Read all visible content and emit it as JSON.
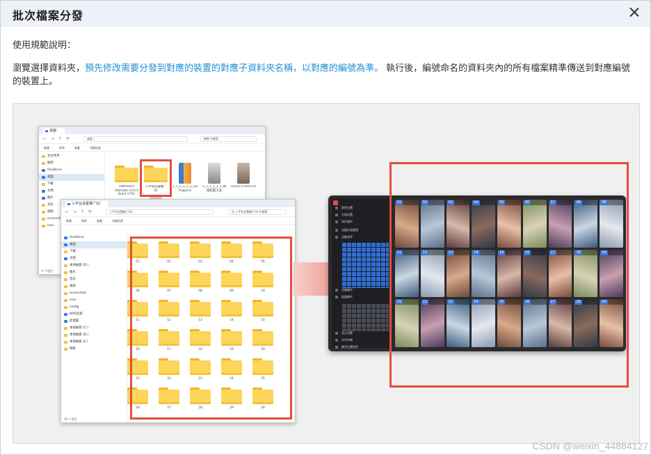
{
  "dialog": {
    "title": "批次檔案分發",
    "usage_label": "使用規範說明：",
    "desc_part1": "瀏覽選擇資料夾，",
    "desc_highlight": "預先修改需要分發到對應的裝置的對應子資料夾名稱，以對應的編號為準。",
    "desc_part2": " 執行後，編號命名的資料夾內的所有檔案精準傳送到對應編號的裝置上。"
  },
  "explorer_back": {
    "tab_label": "桌面",
    "address": "桌面 ›",
    "search_placeholder": "搜尋 中搜索",
    "toolbar": [
      "新建",
      "排序",
      "查看",
      "详细信息"
    ],
    "sidebar": [
      "主文件夹",
      "图库",
      "OneDrive",
      "桌面",
      "下载",
      "文档",
      "图片",
      "音乐",
      "视频",
      "screenshot",
      "core"
    ],
    "files": [
      {
        "name": "VMProtect Ultimate v3.8.4 Build 1754",
        "type": "folder"
      },
      {
        "name": "三平台设置推广02",
        "type": "folder"
      },
      {
        "name": "1_1_1_1_1_1_Sw frogame",
        "type": "zip"
      },
      {
        "name": "1_1_1_1_1_1_网络配置工具",
        "type": "tool"
      },
      {
        "name": "a2521114ef114a6e9bf4c1fcf4a80173a0ff9e0f0f8f7a6d5b325.mp4",
        "type": "video"
      }
    ],
    "status": "6 个项目"
  },
  "explorer_front": {
    "tab_label": "三平台设置推广02",
    "address": "三平台设置推广02 ›",
    "search_placeholder": "在 三平台设置推广02 中搜索",
    "toolbar": [
      "新建",
      "排序",
      "查看",
      "详细信息"
    ],
    "sidebar": [
      "OneDrive",
      "桌面",
      "下载",
      "文档",
      "本地磁盘 (D:)",
      "图片",
      "音乐",
      "视频",
      "screenshot",
      "core",
      "config",
      "WPS云盘",
      "此电脑",
      "本地磁盘 (C:)",
      "本地磁盘 (D:)",
      "本地磁盘 (E:)",
      "网络"
    ],
    "folders": [
      "01",
      "02",
      "03",
      "04",
      "05",
      "06",
      "07",
      "08",
      "09",
      "10",
      "11",
      "12",
      "13",
      "14",
      "15",
      "16",
      "17",
      "18",
      "19",
      "20",
      "21",
      "22",
      "23",
      "24",
      "25",
      "26",
      "27",
      "28",
      "29",
      "30"
    ],
    "status": "30 个项目"
  },
  "device_wall": {
    "sidebar_rows": [
      "群控设置",
      "分组设置",
      "同步操作",
      "设备分组管理",
      "设备排序",
      "设备编号",
      "批量操作",
      "显示设置",
      "文件传输",
      "数字位置排序"
    ],
    "screens": [
      "01",
      "02",
      "03",
      "04",
      "05",
      "06",
      "07",
      "08",
      "09",
      "11",
      "12",
      "13",
      "14",
      "15",
      "16",
      "17",
      "18",
      "19",
      "21",
      "22",
      "23",
      "24",
      "25",
      "26",
      "27",
      "28",
      "29"
    ]
  },
  "colors": {
    "highlight": "#1f8fd6",
    "red_frame": "#e34d41",
    "folder": "#fcd55a"
  },
  "watermark": "CSDN @weixin_44884127"
}
